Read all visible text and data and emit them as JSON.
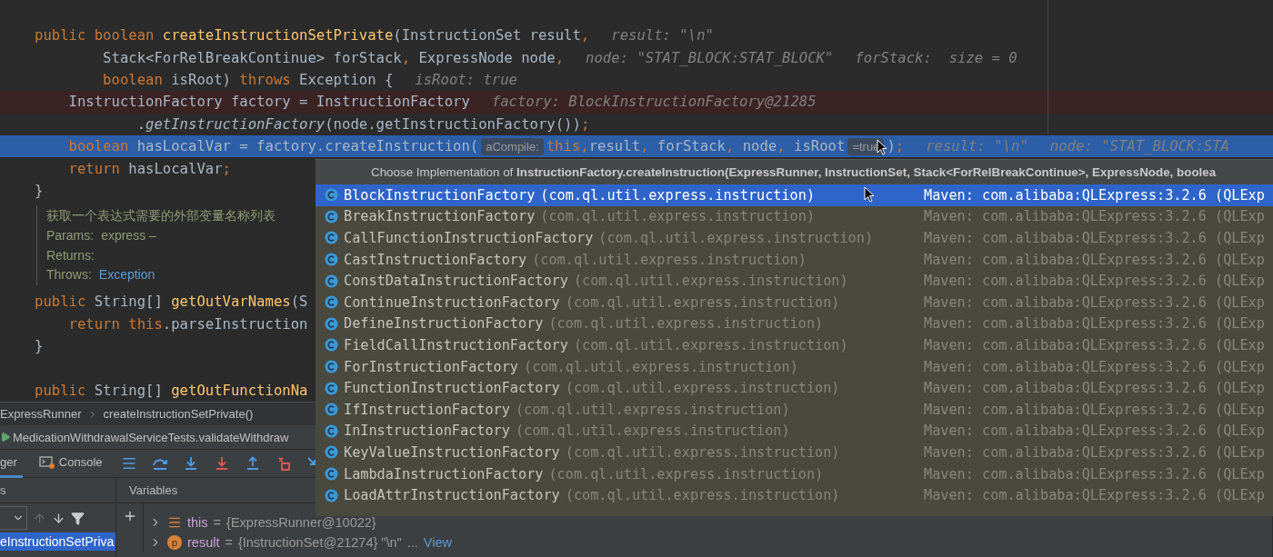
{
  "editor": {
    "lines": [
      {
        "kind": "code",
        "breakpoint": false,
        "current": false,
        "tokens": [
          {
            "t": "public boolean ",
            "kind": "kw"
          },
          {
            "t": "createInstructionSetPrivate",
            "kind": "fn"
          },
          {
            "t": "(InstructionSet result",
            "kind": "txt"
          },
          {
            "t": ",",
            "kind": "punct"
          },
          {
            "t": "result: \"\\n\"",
            "kind": "hint"
          }
        ]
      },
      {
        "kind": "code",
        "breakpoint": false,
        "current": false,
        "tokens": [
          {
            "t": "        Stack<ForRelBreakContinue> forStack",
            "kind": "txt"
          },
          {
            "t": ",",
            "kind": "punct"
          },
          {
            "t": " ExpressNode node",
            "kind": "txt"
          },
          {
            "t": ",",
            "kind": "punct"
          },
          {
            "t": "node: \"STAT_BLOCK:STAT_BLOCK\"",
            "kind": "hint"
          },
          {
            "t": "forStack:  size = 0",
            "kind": "hint"
          }
        ]
      },
      {
        "kind": "code",
        "breakpoint": false,
        "current": false,
        "tokens": [
          {
            "t": "        boolean",
            "kind": "kw"
          },
          {
            "t": " isRoot) ",
            "kind": "txt"
          },
          {
            "t": "throws",
            "kind": "kw"
          },
          {
            "t": " Exception {",
            "kind": "txt"
          },
          {
            "t": "isRoot: true",
            "kind": "hint"
          }
        ]
      },
      {
        "kind": "code",
        "breakpoint": true,
        "current": false,
        "tokens": [
          {
            "t": "    InstructionFactory factory = InstructionFactory",
            "kind": "txt"
          },
          {
            "t": "factory: BlockInstructionFactory@21285",
            "kind": "hint"
          }
        ]
      },
      {
        "kind": "code",
        "breakpoint": false,
        "current": false,
        "tokens": [
          {
            "t": "            .",
            "kind": "txt"
          },
          {
            "t": "getInstructionFactory",
            "kind": "it"
          },
          {
            "t": "(node.getInstructionFactory())",
            "kind": "txt"
          },
          {
            "t": ";",
            "kind": "punct"
          }
        ]
      },
      {
        "kind": "code",
        "breakpoint": false,
        "current": true,
        "tokens": [
          {
            "t": "    boolean",
            "kind": "kw"
          },
          {
            "t": " hasLocalVar = factory.createInstruction(",
            "kind": "txt"
          },
          {
            "t": "aCompile:",
            "kind": "inlay"
          },
          {
            "t": "this",
            "kind": "kw"
          },
          {
            "t": ",",
            "kind": "punct"
          },
          {
            "t": "result",
            "kind": "txt"
          },
          {
            "t": ",",
            "kind": "punct"
          },
          {
            "t": " forStack",
            "kind": "txt"
          },
          {
            "t": ",",
            "kind": "punct"
          },
          {
            "t": " node",
            "kind": "txt"
          },
          {
            "t": ",",
            "kind": "punct"
          },
          {
            "t": " isRoot",
            "kind": "txt"
          },
          {
            "t": "=true",
            "kind": "inlay"
          },
          {
            "t": ")",
            "kind": "txt"
          },
          {
            "t": ";",
            "kind": "punct"
          },
          {
            "t": "result: \"\\n\"",
            "kind": "hint"
          },
          {
            "t": "node: \"STAT_BLOCK:STA",
            "kind": "hint"
          }
        ]
      },
      {
        "kind": "code",
        "breakpoint": false,
        "current": false,
        "tokens": [
          {
            "t": "    return",
            "kind": "kw"
          },
          {
            "t": " hasLocalVar",
            "kind": "txt"
          },
          {
            "t": ";",
            "kind": "punct"
          }
        ]
      },
      {
        "kind": "code",
        "breakpoint": false,
        "current": false,
        "tokens": [
          {
            "t": "}",
            "kind": "txt"
          }
        ]
      },
      {
        "kind": "doc",
        "summary": "获取一个表达式需要的外部变量名称列表",
        "rows": [
          {
            "label": "Params:",
            "value": "express –",
            "link": false
          },
          {
            "label": "Returns:"
          },
          {
            "label": "Throws:",
            "value": "Exception",
            "link": true
          }
        ]
      },
      {
        "kind": "code",
        "breakpoint": false,
        "current": false,
        "tokens": [
          {
            "t": "public",
            "kind": "kw"
          },
          {
            "t": " String[] ",
            "kind": "txt"
          },
          {
            "t": "getOutVarNames",
            "kind": "fn"
          },
          {
            "t": "(S",
            "kind": "txt"
          }
        ]
      },
      {
        "kind": "code",
        "breakpoint": false,
        "current": false,
        "tokens": [
          {
            "t": "    return this",
            "kind": "kw"
          },
          {
            "t": ".parseInstruction",
            "kind": "txt"
          }
        ]
      },
      {
        "kind": "code",
        "breakpoint": false,
        "current": false,
        "tokens": [
          {
            "t": "}",
            "kind": "txt"
          }
        ]
      },
      {
        "kind": "blank"
      },
      {
        "kind": "code",
        "breakpoint": false,
        "current": false,
        "tokens": [
          {
            "t": "public",
            "kind": "kw"
          },
          {
            "t": " String[] ",
            "kind": "txt"
          },
          {
            "t": "getOutFunctionNa",
            "kind": "fn"
          }
        ]
      }
    ]
  },
  "popup": {
    "title": "Choose Implementation of **InstructionFactory.createInstruction(ExpressRunner, InstructionSet, Stack<ForRelBreakContinue>, ExpressNode, boolea**",
    "items": [
      {
        "name": "BlockInstructionFactory",
        "package": "(com.ql.util.express.instruction)",
        "location": "Maven: com.alibaba:QLExpress:3.2.6 (QLExp",
        "selected": true
      },
      {
        "name": "BreakInstructionFactory",
        "package": "(com.ql.util.express.instruction)",
        "location": "Maven: com.alibaba:QLExpress:3.2.6 (QLExp",
        "selected": false
      },
      {
        "name": "CallFunctionInstructionFactory",
        "package": "(com.ql.util.express.instruction)",
        "location": "Maven: com.alibaba:QLExpress:3.2.6 (QLExp",
        "selected": false
      },
      {
        "name": "CastInstructionFactory",
        "package": "(com.ql.util.express.instruction)",
        "location": "Maven: com.alibaba:QLExpress:3.2.6 (QLExp",
        "selected": false
      },
      {
        "name": "ConstDataInstructionFactory",
        "package": "(com.ql.util.express.instruction)",
        "location": "Maven: com.alibaba:QLExpress:3.2.6 (QLExp",
        "selected": false
      },
      {
        "name": "ContinueInstructionFactory",
        "package": "(com.ql.util.express.instruction)",
        "location": "Maven: com.alibaba:QLExpress:3.2.6 (QLExp",
        "selected": false
      },
      {
        "name": "DefineInstructionFactory",
        "package": "(com.ql.util.express.instruction)",
        "location": "Maven: com.alibaba:QLExpress:3.2.6 (QLExp",
        "selected": false
      },
      {
        "name": "FieldCallInstructionFactory",
        "package": "(com.ql.util.express.instruction)",
        "location": "Maven: com.alibaba:QLExpress:3.2.6 (QLExp",
        "selected": false
      },
      {
        "name": "ForInstructionFactory",
        "package": "(com.ql.util.express.instruction)",
        "location": "Maven: com.alibaba:QLExpress:3.2.6 (QLExp",
        "selected": false
      },
      {
        "name": "FunctionInstructionFactory",
        "package": "(com.ql.util.express.instruction)",
        "location": "Maven: com.alibaba:QLExpress:3.2.6 (QLExp",
        "selected": false
      },
      {
        "name": "IfInstructionFactory",
        "package": "(com.ql.util.express.instruction)",
        "location": "Maven: com.alibaba:QLExpress:3.2.6 (QLExp",
        "selected": false
      },
      {
        "name": "InInstructionFactory",
        "package": "(com.ql.util.express.instruction)",
        "location": "Maven: com.alibaba:QLExpress:3.2.6 (QLExp",
        "selected": false
      },
      {
        "name": "KeyValueInstructionFactory",
        "package": "(com.ql.util.express.instruction)",
        "location": "Maven: com.alibaba:QLExpress:3.2.6 (QLExp",
        "selected": false
      },
      {
        "name": "LambdaInstructionFactory",
        "package": "(com.ql.util.express.instruction)",
        "location": "Maven: com.alibaba:QLExpress:3.2.6 (QLExp",
        "selected": false
      },
      {
        "name": "LoadAttrInstructionFactory",
        "package": "(com.ql.util.express.instruction)",
        "location": "Maven: com.alibaba:QLExpress:3.2.6 (QLExp",
        "selected": false
      }
    ]
  },
  "breadcrumb": [
    "ExpressRunner",
    "createInstructionSetPrivate()"
  ],
  "run_tab": {
    "label": "MedicationWithdrawalServiceTests.validateWithdraw"
  },
  "debug_tabs": [
    {
      "label": "ger",
      "selected": true,
      "kind": "debugger"
    },
    {
      "label": "Console",
      "selected": false,
      "kind": "console"
    }
  ],
  "frames": {
    "header": "s",
    "items": [
      {
        "label": "eInstructionSetPriva",
        "selected": true
      }
    ]
  },
  "variables": {
    "header": "Variables",
    "items": [
      {
        "kind": "field",
        "name": "this",
        "equals": "=",
        "value": "{ExpressRunner@10022}"
      },
      {
        "kind": "param",
        "badge": "p",
        "name": "result",
        "equals": "=",
        "value": "{InstructionSet@21274} \"\\n\"",
        "suffix": "...",
        "link": "View"
      }
    ]
  }
}
